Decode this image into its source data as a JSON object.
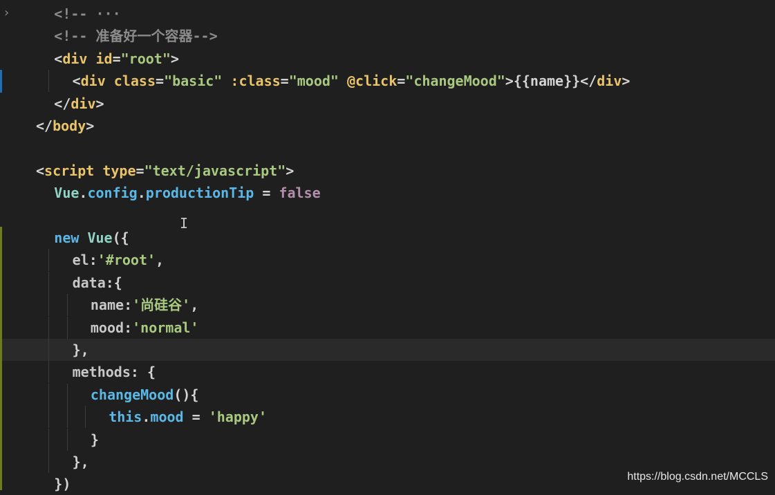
{
  "editor": {
    "lines": [
      {
        "indent": 1,
        "fold": true,
        "tokens": [
          {
            "t": "<!-- ",
            "c": "#8c8c8c"
          },
          {
            "t": "···",
            "c": "#8c8c8c"
          }
        ]
      },
      {
        "indent": 1,
        "tokens": [
          {
            "t": "<!-- 准备好一个容器-->",
            "c": "#8c8c8c"
          }
        ]
      },
      {
        "indent": 1,
        "tokens": [
          {
            "t": "<",
            "c": "#d4d4d4"
          },
          {
            "t": "div",
            "c": "#e9c46a"
          },
          {
            "t": " id",
            "c": "#e9c46a"
          },
          {
            "t": "=",
            "c": "#d4d4d4"
          },
          {
            "t": "\"root\"",
            "c": "#a8c97f"
          },
          {
            "t": ">",
            "c": "#d4d4d4"
          }
        ]
      },
      {
        "indent": 2,
        "tokens": [
          {
            "t": "<",
            "c": "#d4d4d4"
          },
          {
            "t": "div",
            "c": "#e9c46a"
          },
          {
            "t": " class",
            "c": "#e9c46a"
          },
          {
            "t": "=",
            "c": "#d4d4d4"
          },
          {
            "t": "\"basic\"",
            "c": "#a8c97f"
          },
          {
            "t": " :class",
            "c": "#e9c46a"
          },
          {
            "t": "=",
            "c": "#d4d4d4"
          },
          {
            "t": "\"mood\"",
            "c": "#a8c97f"
          },
          {
            "t": " @click",
            "c": "#e9c46a"
          },
          {
            "t": "=",
            "c": "#d4d4d4"
          },
          {
            "t": "\"changeMood\"",
            "c": "#a8c97f"
          },
          {
            "t": ">{{name}}</",
            "c": "#d4d4d4"
          },
          {
            "t": "div",
            "c": "#e9c46a"
          },
          {
            "t": ">",
            "c": "#d4d4d4"
          }
        ]
      },
      {
        "indent": 1,
        "tokens": [
          {
            "t": "</",
            "c": "#d4d4d4"
          },
          {
            "t": "div",
            "c": "#e9c46a"
          },
          {
            "t": ">",
            "c": "#d4d4d4"
          }
        ]
      },
      {
        "indent": 0,
        "tokens": [
          {
            "t": "</",
            "c": "#d4d4d4"
          },
          {
            "t": "body",
            "c": "#e9c46a"
          },
          {
            "t": ">",
            "c": "#d4d4d4"
          }
        ]
      },
      {
        "indent": 0,
        "tokens": []
      },
      {
        "indent": 0,
        "tokens": [
          {
            "t": "<",
            "c": "#d4d4d4"
          },
          {
            "t": "script",
            "c": "#e9c46a"
          },
          {
            "t": " type",
            "c": "#e9c46a"
          },
          {
            "t": "=",
            "c": "#d4d4d4"
          },
          {
            "t": "\"text/javascript\"",
            "c": "#a8c97f"
          },
          {
            "t": ">",
            "c": "#d4d4d4"
          }
        ]
      },
      {
        "indent": 1,
        "tokens": [
          {
            "t": "Vue",
            "c": "#8fd4c4"
          },
          {
            "t": ".",
            "c": "#d4d4d4"
          },
          {
            "t": "config",
            "c": "#5bb8e6"
          },
          {
            "t": ".",
            "c": "#d4d4d4"
          },
          {
            "t": "productionTip",
            "c": "#5bb8e6"
          },
          {
            "t": " = ",
            "c": "#d4d4d4"
          },
          {
            "t": "false",
            "c": "#b48ead"
          }
        ]
      },
      {
        "indent": 0,
        "tokens": []
      },
      {
        "indent": 1,
        "tokens": [
          {
            "t": "new ",
            "c": "#5bb8e6"
          },
          {
            "t": "Vue",
            "c": "#8fd4c4"
          },
          {
            "t": "({",
            "c": "#d4d4d4"
          }
        ]
      },
      {
        "indent": 2,
        "tokens": [
          {
            "t": "el",
            "c": "#c8c8c8"
          },
          {
            "t": ":",
            "c": "#d4d4d4"
          },
          {
            "t": "'#root'",
            "c": "#a8c97f"
          },
          {
            "t": ",",
            "c": "#d4d4d4"
          }
        ]
      },
      {
        "indent": 2,
        "tokens": [
          {
            "t": "data",
            "c": "#c8c8c8"
          },
          {
            "t": ":{",
            "c": "#d4d4d4"
          }
        ]
      },
      {
        "indent": 3,
        "tokens": [
          {
            "t": "name",
            "c": "#c8c8c8"
          },
          {
            "t": ":",
            "c": "#d4d4d4"
          },
          {
            "t": "'尚硅谷'",
            "c": "#a8c97f"
          },
          {
            "t": ",",
            "c": "#d4d4d4"
          }
        ]
      },
      {
        "indent": 3,
        "tokens": [
          {
            "t": "mood",
            "c": "#c8c8c8"
          },
          {
            "t": ":",
            "c": "#d4d4d4"
          },
          {
            "t": "'normal'",
            "c": "#a8c97f"
          }
        ]
      },
      {
        "indent": 2,
        "current": true,
        "tokens": [
          {
            "t": "},",
            "c": "#d4d4d4"
          }
        ]
      },
      {
        "indent": 2,
        "tokens": [
          {
            "t": "methods",
            "c": "#c8c8c8"
          },
          {
            "t": ": {",
            "c": "#d4d4d4"
          }
        ]
      },
      {
        "indent": 3,
        "tokens": [
          {
            "t": "changeMood",
            "c": "#5bb8e6"
          },
          {
            "t": "(){",
            "c": "#d4d4d4"
          }
        ]
      },
      {
        "indent": 4,
        "tokens": [
          {
            "t": "this",
            "c": "#5bb8e6"
          },
          {
            "t": ".",
            "c": "#d4d4d4"
          },
          {
            "t": "mood",
            "c": "#5bb8e6"
          },
          {
            "t": " = ",
            "c": "#d4d4d4"
          },
          {
            "t": "'happy'",
            "c": "#a8c97f"
          }
        ]
      },
      {
        "indent": 3,
        "tokens": [
          {
            "t": "}",
            "c": "#d4d4d4"
          }
        ]
      },
      {
        "indent": 2,
        "tokens": [
          {
            "t": "},",
            "c": "#d4d4d4"
          }
        ]
      },
      {
        "indent": 1,
        "tokens": [
          {
            "t": "})",
            "c": "#d4d4d4"
          }
        ]
      }
    ]
  },
  "fold_icon": "chevron-right-icon",
  "watermark": "https://blog.csdn.net/MCCLS",
  "colors": {
    "background": "#1f1f1f",
    "current_line": "#2a2a2a",
    "modified_marker": "#1f6fb2",
    "added_marker": "#6b7d1e"
  }
}
